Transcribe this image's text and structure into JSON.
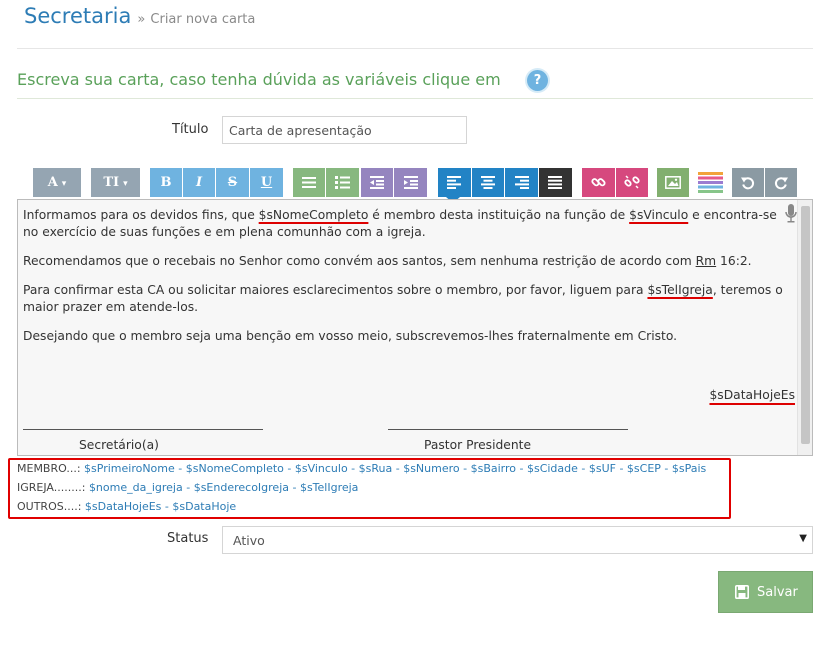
{
  "breadcrumb": {
    "title": "Secretaria",
    "separator": "»",
    "current": "Criar nova carta"
  },
  "heading": {
    "text": "Escreva sua carta, caso tenha dúvida as variáveis clique em",
    "help_icon": "?"
  },
  "form": {
    "title_label": "Título",
    "title_value": "Carta de apresentação",
    "status_label": "Status",
    "status_value": "Ativo",
    "status_caret": "▼"
  },
  "toolbar": {
    "font_button": "A",
    "size_button": "TI",
    "caret": "▾",
    "bold": "B",
    "italic": "I",
    "strike": "S",
    "underline": "U"
  },
  "editor": {
    "p1_a": "Informamos para os devidos fins, que ",
    "p1_var1": "$sNomeCompleto",
    "p1_b": " é membro desta instituição na função de ",
    "p1_var2": "$sVinculo",
    "p1_c": " e encontra-se no exercício de suas funções e em plena comunhão com a igreja.",
    "p2_a": "Recomendamos que o recebais no Senhor como convém aos santos, sem nenhuma restrição de acordo com ",
    "p2_rm": "Rm",
    "p2_b": " 16:2.",
    "p3_a": "Para confirmar esta CA ou solicitar maiores esclarecimentos sobre o membro, por favor, liguem para ",
    "p3_var": "$sTelIgreja",
    "p3_b": ", teremos o maior prazer em atende-los.",
    "p4": "Desejando que o membro seja uma benção em vosso meio, subscrevemos-lhes fraternalmente em Cristo.",
    "date_var": "$sDataHojeEs",
    "sig_left": "Secretário(a)",
    "sig_right": "Pastor Presidente"
  },
  "variables": {
    "membro_label": "MEMBRO...:",
    "membro_list": "$sPrimeiroNome - $sNomeCompleto - $sVinculo - $sRua - $sNumero - $sBairro - $sCidade - $sUF - $sCEP - $sPais",
    "igreja_label": "IGREJA........:",
    "igreja_list": "$nome_da_igreja - $sEnderecoIgreja - $sTelIgreja",
    "outros_label": "OUTROS....:",
    "outros_list": "$sDataHojeEs - $sDataHoje"
  },
  "actions": {
    "save_label": "Salvar"
  },
  "colors": {
    "link_blue": "#2d7cb5",
    "heading_green": "#5aa15a",
    "save_green": "#87b87f",
    "highlight_red": "#e00000"
  },
  "icons": [
    "help-icon",
    "list-icon",
    "ordered-list-icon",
    "outdent-icon",
    "indent-icon",
    "align-left-icon",
    "align-center-icon",
    "align-right-icon",
    "justify-icon",
    "link-icon",
    "unlink-icon",
    "image-icon",
    "color-palette-icon",
    "undo-icon",
    "redo-icon",
    "microphone-icon",
    "save-icon"
  ]
}
